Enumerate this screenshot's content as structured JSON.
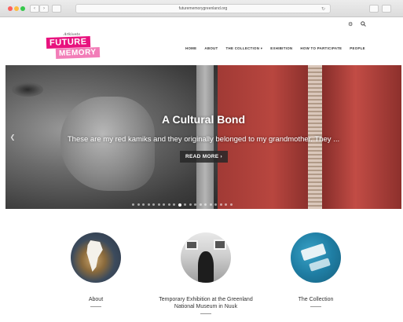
{
  "browser": {
    "url": "futurememorygreenland.org",
    "back_label": "‹",
    "forward_label": "›",
    "reload_label": "↻"
  },
  "header": {
    "logo_small": "Arkivets",
    "logo_line1": "FUTURE",
    "logo_line2": "MEMORY",
    "search_icon": "search-icon",
    "settings_icon": "gear-icon",
    "nav": [
      "HOME",
      "ABOUT",
      "THE COLLECTION ▾",
      "EXHIBITION",
      "HOW TO PARTICIPATE",
      "PEOPLE"
    ]
  },
  "hero": {
    "title": "A Cultural Bond",
    "subtitle": "These are my red kamiks and they originally belonged to my grandmother. They ...",
    "button": "READ MORE ›",
    "prev_icon": "chevron-left-icon",
    "slide_count": 20,
    "active_slide": 9
  },
  "features": [
    {
      "label": "About"
    },
    {
      "label": "Temporary Exhibition at the Greenland National Museum in Nuuk"
    },
    {
      "label": "The Collection"
    }
  ],
  "colors": {
    "brand_pink": "#e8127e",
    "brand_pink_light": "#f27db8"
  }
}
